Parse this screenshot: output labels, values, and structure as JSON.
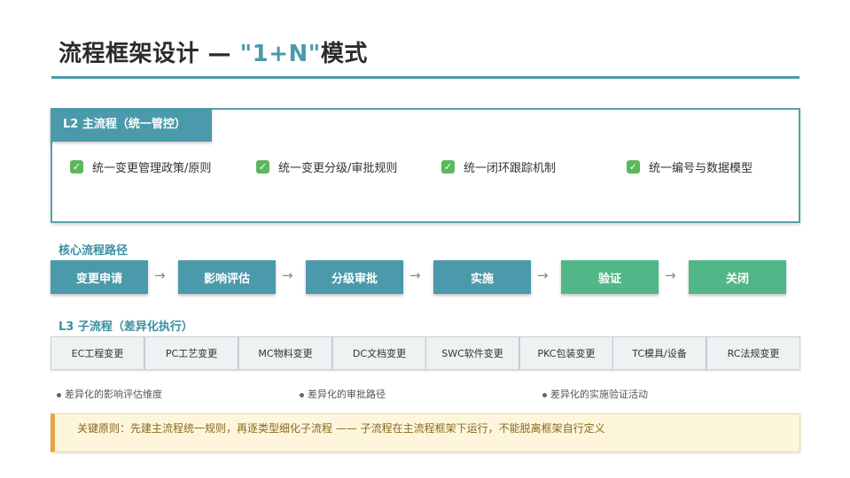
{
  "title": {
    "prefix": "流程框架设计 — ",
    "accent": "\"1+N\"",
    "suffix": "模式"
  },
  "l2": {
    "tab_label": "L2 主流程（统一管控）",
    "items": [
      "统一变更管理政策/原则",
      "统一变更分级/审批规则",
      "统一闭环跟踪机制",
      "统一编号与数据模型"
    ]
  },
  "core_flow": {
    "label": "核心流程路径",
    "arrow": "→",
    "steps": [
      "变更申请",
      "影响评估",
      "分级审批",
      "实施",
      "验证",
      "关闭"
    ],
    "colors": {
      "primary": "#4a9aab",
      "final": "#52b788"
    }
  },
  "l3": {
    "label": "L3 子流程（差异化执行）",
    "items": [
      "EC工程变更",
      "PC工艺变更",
      "MC物料变更",
      "DC文档变更",
      "SWC软件变更",
      "PKC包装变更",
      "TC模具/设备",
      "RC法规变更"
    ]
  },
  "bullets": [
    "差异化的影响评估维度",
    "差异化的审批路径",
    "差异化的实施验证活动"
  ],
  "key_principle": "关键原则：先建主流程统一规则，再逐类型细化子流程 —— 子流程在主流程框架下运行，不能脱离框架自行定义"
}
